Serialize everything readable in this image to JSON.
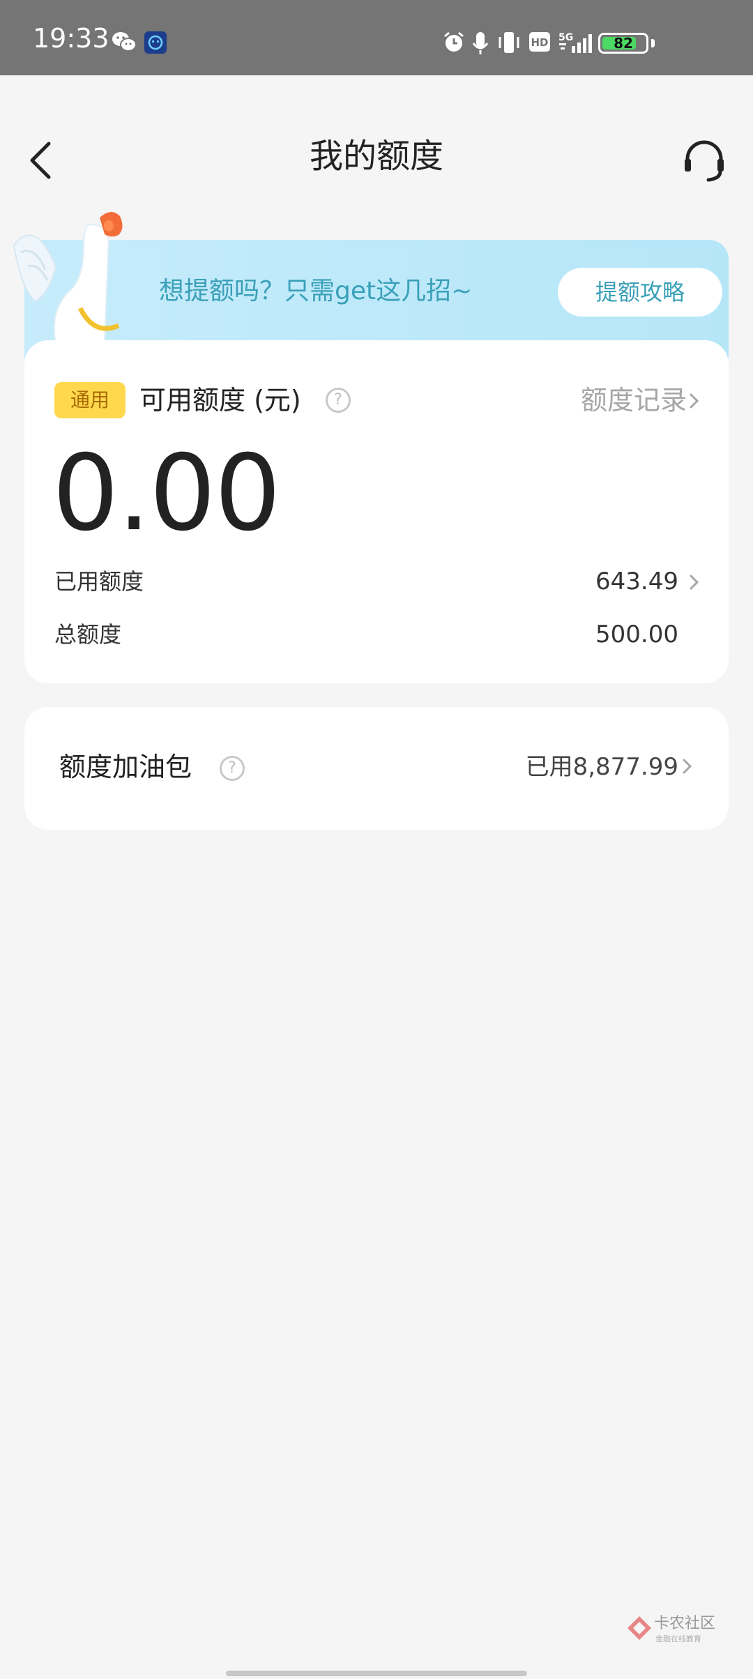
{
  "status_bar": {
    "time": "19:33",
    "battery_level": "82",
    "battery_fraction": 0.82,
    "icons": [
      "wechat-icon",
      "app-notification-icon",
      "alarm-icon",
      "mic-icon",
      "vibrate-icon",
      "hd-icon",
      "5g-signal-icon",
      "battery-icon"
    ],
    "hd_text": "HD",
    "net_text": "5G"
  },
  "nav": {
    "title": "我的额度"
  },
  "banner": {
    "text": "想提额吗？只需get这几招~",
    "button": "提额攻略"
  },
  "quota_card": {
    "tag": "通用",
    "available_label": "可用额度 (元)",
    "records_link": "额度记录",
    "available_amount": "0.00",
    "used_label": "已用额度",
    "used_value": "643.49",
    "total_label": "总额度",
    "total_value": "500.00"
  },
  "fuel_card": {
    "label": "额度加油包",
    "value": "已用8,877.99"
  },
  "watermark": {
    "name": "卡农社区",
    "tagline": "金融在线教育"
  },
  "colors": {
    "accent_text": "#3aa0b8",
    "banner_bg": "#c6ecfb",
    "tag_bg": "#ffd84d",
    "tag_text": "#a86a00",
    "page_bg": "#f5f5f5",
    "status_bg": "#757575"
  }
}
